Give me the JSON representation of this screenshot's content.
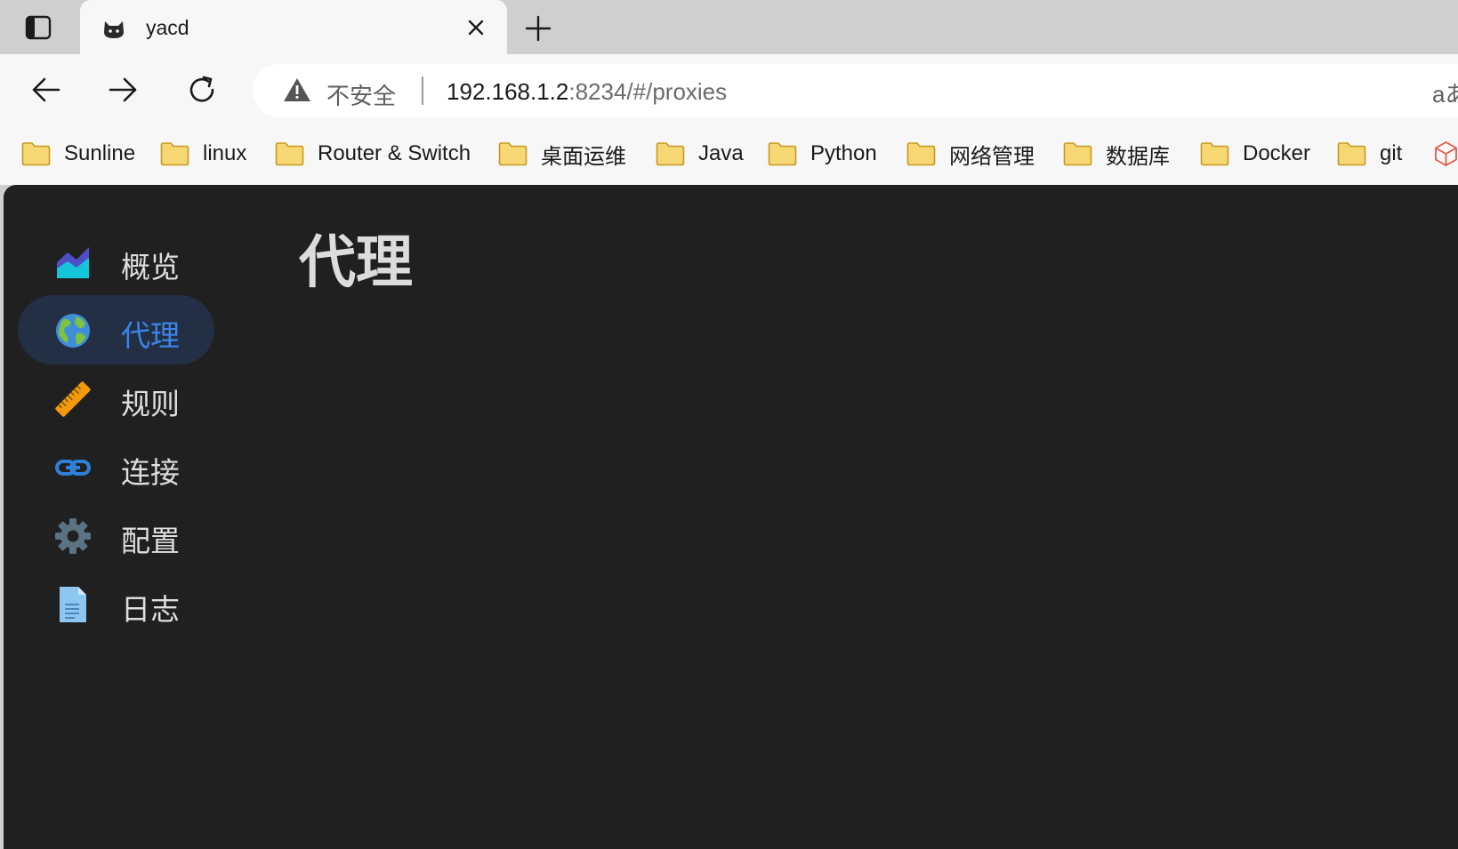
{
  "tab": {
    "title": "yacd",
    "favicon": "cat-icon"
  },
  "omnibox": {
    "security_label": "不安全",
    "url_host": "192.168.1.2",
    "url_rest": ":8234/#/proxies",
    "read_aloud_label": "aあ"
  },
  "bookmarks": [
    {
      "label": "Sunline"
    },
    {
      "label": "linux"
    },
    {
      "label": "Router & Switch"
    },
    {
      "label": "桌面运维"
    },
    {
      "label": "Java"
    },
    {
      "label": "Python"
    },
    {
      "label": "网络管理"
    },
    {
      "label": "数据库"
    },
    {
      "label": "Docker"
    },
    {
      "label": "git"
    }
  ],
  "sidebar": {
    "items": [
      {
        "label": "概览",
        "icon": "chart-area-icon",
        "active": false
      },
      {
        "label": "代理",
        "icon": "globe-icon",
        "active": true
      },
      {
        "label": "规则",
        "icon": "ruler-icon",
        "active": false
      },
      {
        "label": "连接",
        "icon": "link-icon",
        "active": false
      },
      {
        "label": "配置",
        "icon": "gear-icon",
        "active": false
      },
      {
        "label": "日志",
        "icon": "document-icon",
        "active": false
      }
    ]
  },
  "main": {
    "title": "代理"
  },
  "colors": {
    "app_bg": "#202020",
    "active_item_bg": "#232f45",
    "active_text": "#3a86e8"
  }
}
